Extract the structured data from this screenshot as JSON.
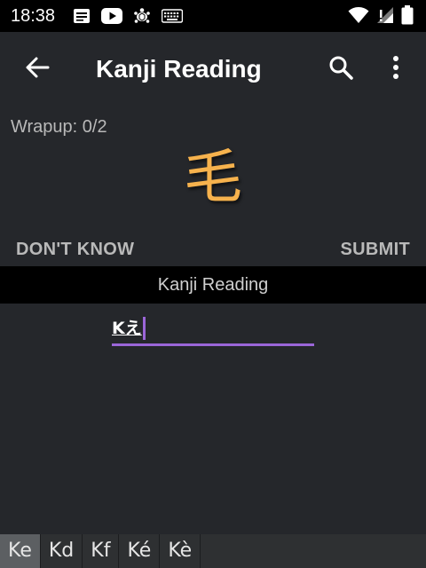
{
  "status_bar": {
    "time": "18:38",
    "left_icons": [
      "notes-icon",
      "youtube-icon",
      "turtle-icon",
      "keyboard-icon"
    ],
    "right_icons": [
      "wifi-icon",
      "cell-signal-icon",
      "battery-icon"
    ]
  },
  "app_bar": {
    "title": "Kanji Reading",
    "back_icon": "arrow-left-icon",
    "search_icon": "search-icon",
    "overflow_icon": "more-vertical-icon"
  },
  "question": {
    "wrapup": "Wrapup: 0/2",
    "kanji": "毛",
    "dont_know_label": "DON'T KNOW",
    "submit_label": "SUBMIT",
    "question_type": "Kanji Reading"
  },
  "answer": {
    "value": "Kえ"
  },
  "suggestions": [
    {
      "label": "Ke",
      "active": true
    },
    {
      "label": "Kd",
      "active": false
    },
    {
      "label": "Kf",
      "active": false
    },
    {
      "label": "Ké",
      "active": false
    },
    {
      "label": "Kè",
      "active": false
    }
  ],
  "colors": {
    "background": "#25272b",
    "kanji": "#f6b24d",
    "accent": "#9b66d8",
    "banner": "#000000"
  }
}
